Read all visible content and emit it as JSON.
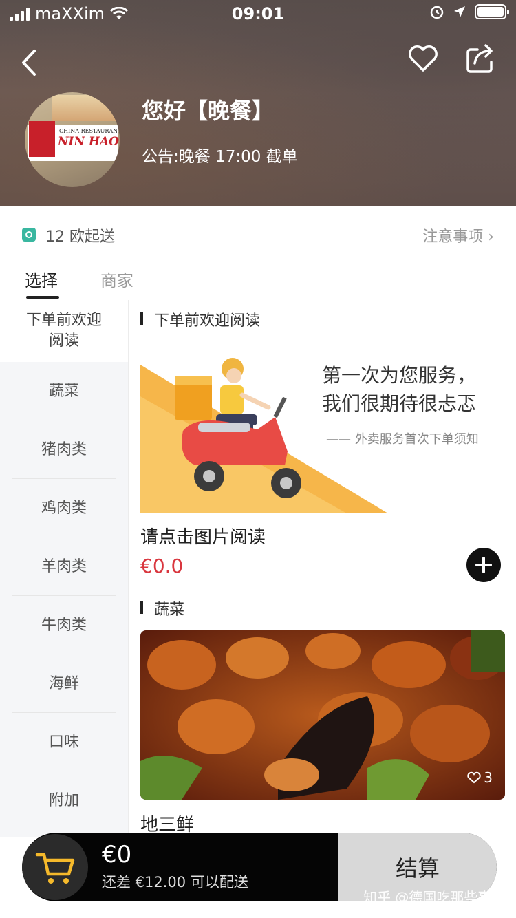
{
  "status_bar": {
    "carrier": "maXXim",
    "time": "09:01"
  },
  "store": {
    "name": "您好【晚餐】",
    "notice": "公告:晚餐 17:00 截单",
    "logo_caption": "CHINA RESTAURANT",
    "logo_name": "NIN HAO"
  },
  "info": {
    "minimum_delivery": "12 欧起送",
    "notes_link": "注意事项 ›"
  },
  "tabs": [
    {
      "label": "选择",
      "active": true
    },
    {
      "label": "商家",
      "active": false
    }
  ],
  "sidebar": {
    "items": [
      {
        "label": "下单前欢迎阅读",
        "active": true
      },
      {
        "label": "蔬菜",
        "active": false
      },
      {
        "label": "猪肉类",
        "active": false
      },
      {
        "label": "鸡肉类",
        "active": false
      },
      {
        "label": "羊肉类",
        "active": false
      },
      {
        "label": "牛肉类",
        "active": false
      },
      {
        "label": "海鲜",
        "active": false
      },
      {
        "label": "口味",
        "active": false
      },
      {
        "label": "附加",
        "active": false
      }
    ]
  },
  "sections": [
    {
      "title": "下单前欢迎阅读",
      "promo_headline_line1": "第一次为您服务，",
      "promo_headline_line2": "我们很期待很忐忑",
      "promo_sub": "—— 外卖服务首次下单须知",
      "item_name": "请点击图片阅读",
      "item_price": "€0.0"
    },
    {
      "title": "蔬菜",
      "item_name": "地三鲜",
      "like_count": "3"
    }
  ],
  "cart": {
    "total": "€0",
    "gap_text": "还差 €12.00 可以配送",
    "checkout_label": "结算"
  },
  "watermark": "知乎 @德国吃那些事",
  "colors": {
    "price": "#d9363e",
    "accent_green": "#39b7a0",
    "promo_orange": "#f6b64a",
    "cart_bar": "#050505",
    "checkout_bg": "#d8d8d8"
  },
  "icons": {
    "back": "chevron-left-icon",
    "favorite": "heart-icon",
    "share": "share-icon",
    "cart": "cart-icon",
    "add": "plus-icon"
  }
}
